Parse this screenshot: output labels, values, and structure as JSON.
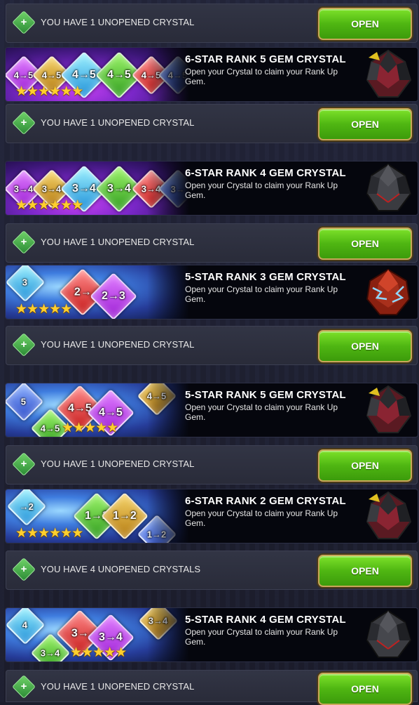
{
  "colors": {
    "open_button": "#4fb612",
    "status_bar": "#2f3241",
    "star": "#ffcf2e"
  },
  "open_label": "OPEN",
  "description": "Open your Crystal to claim your Rank Up Gem.",
  "top_status": {
    "message": "YOU HAVE 1 UNOPENED CRYSTAL"
  },
  "crystals": [
    {
      "title": "6-STAR RANK 5 GEM CRYSTAL",
      "stars": "★★★★★★",
      "gem_labels": [
        "4→5",
        "4→5",
        "4→5",
        "4→5",
        "4→5",
        "4→5"
      ],
      "crystal_icon": "dark-crystal-red",
      "status": "YOU HAVE 1 UNOPENED CRYSTAL"
    },
    {
      "title": "6-STAR RANK 4 GEM CRYSTAL",
      "stars": "★★★★★★",
      "gem_labels": [
        "3→4",
        "3→4",
        "3→4",
        "3→4",
        "3→4",
        "3→"
      ],
      "crystal_icon": "dark-crystal-grey",
      "status": "YOU HAVE 1 UNOPENED CRYSTAL"
    },
    {
      "title": "5-STAR RANK 3 GEM CRYSTAL",
      "stars": "★★★★★",
      "gem_labels": [
        "3",
        "2→",
        "2→3"
      ],
      "crystal_icon": "red-crystal-lightning",
      "status": "YOU HAVE 1 UNOPENED CRYSTAL"
    },
    {
      "title": "5-STAR RANK 5 GEM CRYSTAL",
      "stars": "★★★★★",
      "gem_labels": [
        "5",
        "4→5",
        "4→5",
        "4→5",
        "4→5"
      ],
      "crystal_icon": "dark-crystal-red",
      "status": "YOU HAVE 1 UNOPENED CRYSTAL"
    },
    {
      "title": "6-STAR RANK 2 GEM CRYSTAL",
      "stars": "★★★★★★",
      "gem_labels": [
        "→2",
        "1→2",
        "1→2",
        "1→2"
      ],
      "crystal_icon": "dark-crystal-red",
      "status": "YOU HAVE 4 UNOPENED CRYSTALS"
    },
    {
      "title": "5-STAR RANK 4 GEM CRYSTAL",
      "stars": "★★★★★",
      "gem_labels": [
        "4",
        "3→",
        "3→4",
        "3→4",
        "3→4"
      ],
      "crystal_icon": "dark-crystal-grey",
      "status": "YOU HAVE 1 UNOPENED CRYSTAL"
    }
  ]
}
